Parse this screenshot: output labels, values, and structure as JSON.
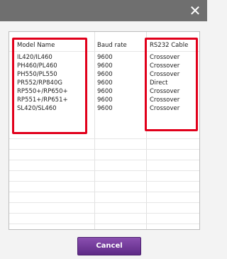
{
  "dialog": {
    "close_glyph": "✕"
  },
  "table": {
    "headers": {
      "model": "Model Name",
      "baud": "Baud rate",
      "cable": "RS232 Cable"
    },
    "rows": [
      {
        "model": "IL420/IL460",
        "baud": "9600",
        "cable": "Crossover"
      },
      {
        "model": "PH460/PL460",
        "baud": "9600",
        "cable": "Crossover"
      },
      {
        "model": "PH550/PL550",
        "baud": "9600",
        "cable": "Crossover"
      },
      {
        "model": "PR552/RP840G",
        "baud": "9600",
        "cable": "Direct"
      },
      {
        "model": "RP550+/RP650+",
        "baud": "9600",
        "cable": "Crossover"
      },
      {
        "model": "RP551+/RP651+",
        "baud": "9600",
        "cable": "Crossover"
      },
      {
        "model": "SL420/SL460",
        "baud": "9600",
        "cable": "Crossover"
      }
    ]
  },
  "footer": {
    "cancel_label": "Cancel"
  },
  "colors": {
    "highlight": "#e1001b",
    "button": "#6b3494",
    "titlebar": "#6f6f6f"
  }
}
